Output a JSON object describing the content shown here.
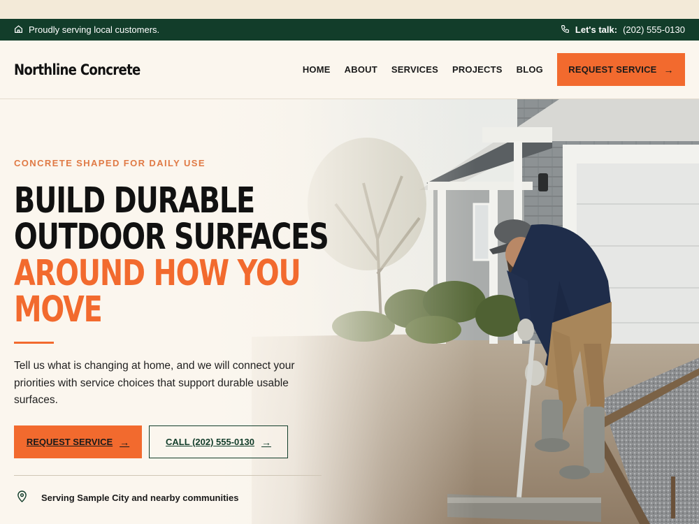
{
  "topbar": {
    "tagline": "Proudly serving local customers.",
    "phone_label": "Let's talk:",
    "phone": "(202) 555-0130"
  },
  "header": {
    "logo": "Northline Concrete",
    "nav": [
      "HOME",
      "ABOUT",
      "SERVICES",
      "PROJECTS",
      "BLOG"
    ],
    "cta": "REQUEST SERVICE"
  },
  "hero": {
    "eyebrow": "CONCRETE SHAPED FOR DAILY USE",
    "headline_dark": [
      "BUILD DURABLE",
      "OUTDOOR SURFACES"
    ],
    "headline_accent": [
      "AROUND HOW YOU",
      "MOVE"
    ],
    "lead": "Tell us what is changing at home, and we will connect your priorities with service choices that support durable usable surfaces.",
    "primary_cta": "REQUEST SERVICE",
    "secondary_cta": "CALL (202) 555-0130",
    "service_area": "Serving Sample City and nearby communities"
  },
  "icons": {
    "home": "home-icon",
    "phone": "phone-icon",
    "arrow": "arrow-right-icon",
    "location": "map-pin-icon"
  },
  "colors": {
    "brand_green": "#123d2a",
    "accent_orange": "#f26a2e",
    "cream": "#fbf6ee"
  }
}
